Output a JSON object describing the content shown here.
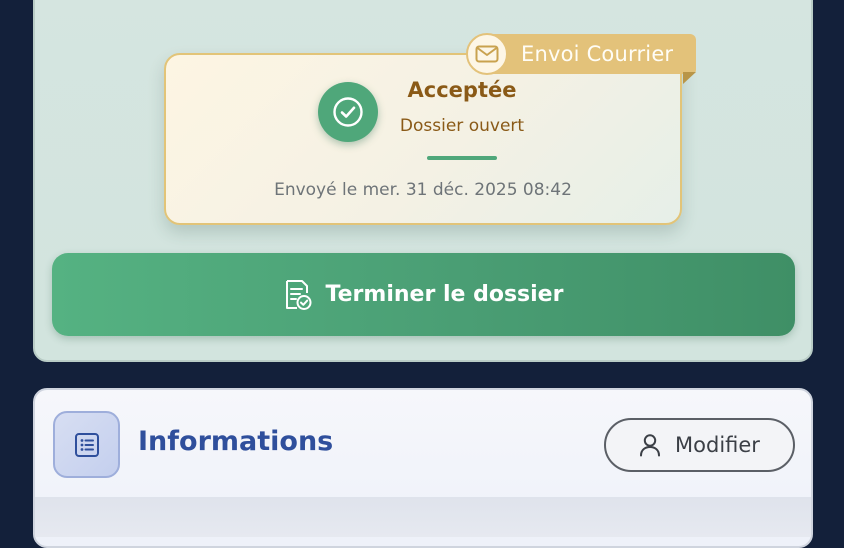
{
  "status_card": {
    "ribbon_label": "Envoi Courrier",
    "status_title": "Acceptée",
    "status_subtitle": "Dossier ouvert",
    "sent_date": "Envoyé le mer. 31 déc. 2025 08:42",
    "accent_color": "#4fa77a",
    "ribbon_color": "#e3c27a",
    "icons": {
      "ribbon": "mail-icon",
      "status": "check-circle-icon"
    }
  },
  "actions": {
    "finish_label": "Terminer le dossier",
    "finish_icon": "document-check-icon",
    "finish_color": "#4fa77a"
  },
  "info_section": {
    "title": "Informations",
    "title_icon": "list-icon",
    "edit_label": "Modifier",
    "edit_icon": "user-icon",
    "title_color": "#2f4f9c"
  }
}
